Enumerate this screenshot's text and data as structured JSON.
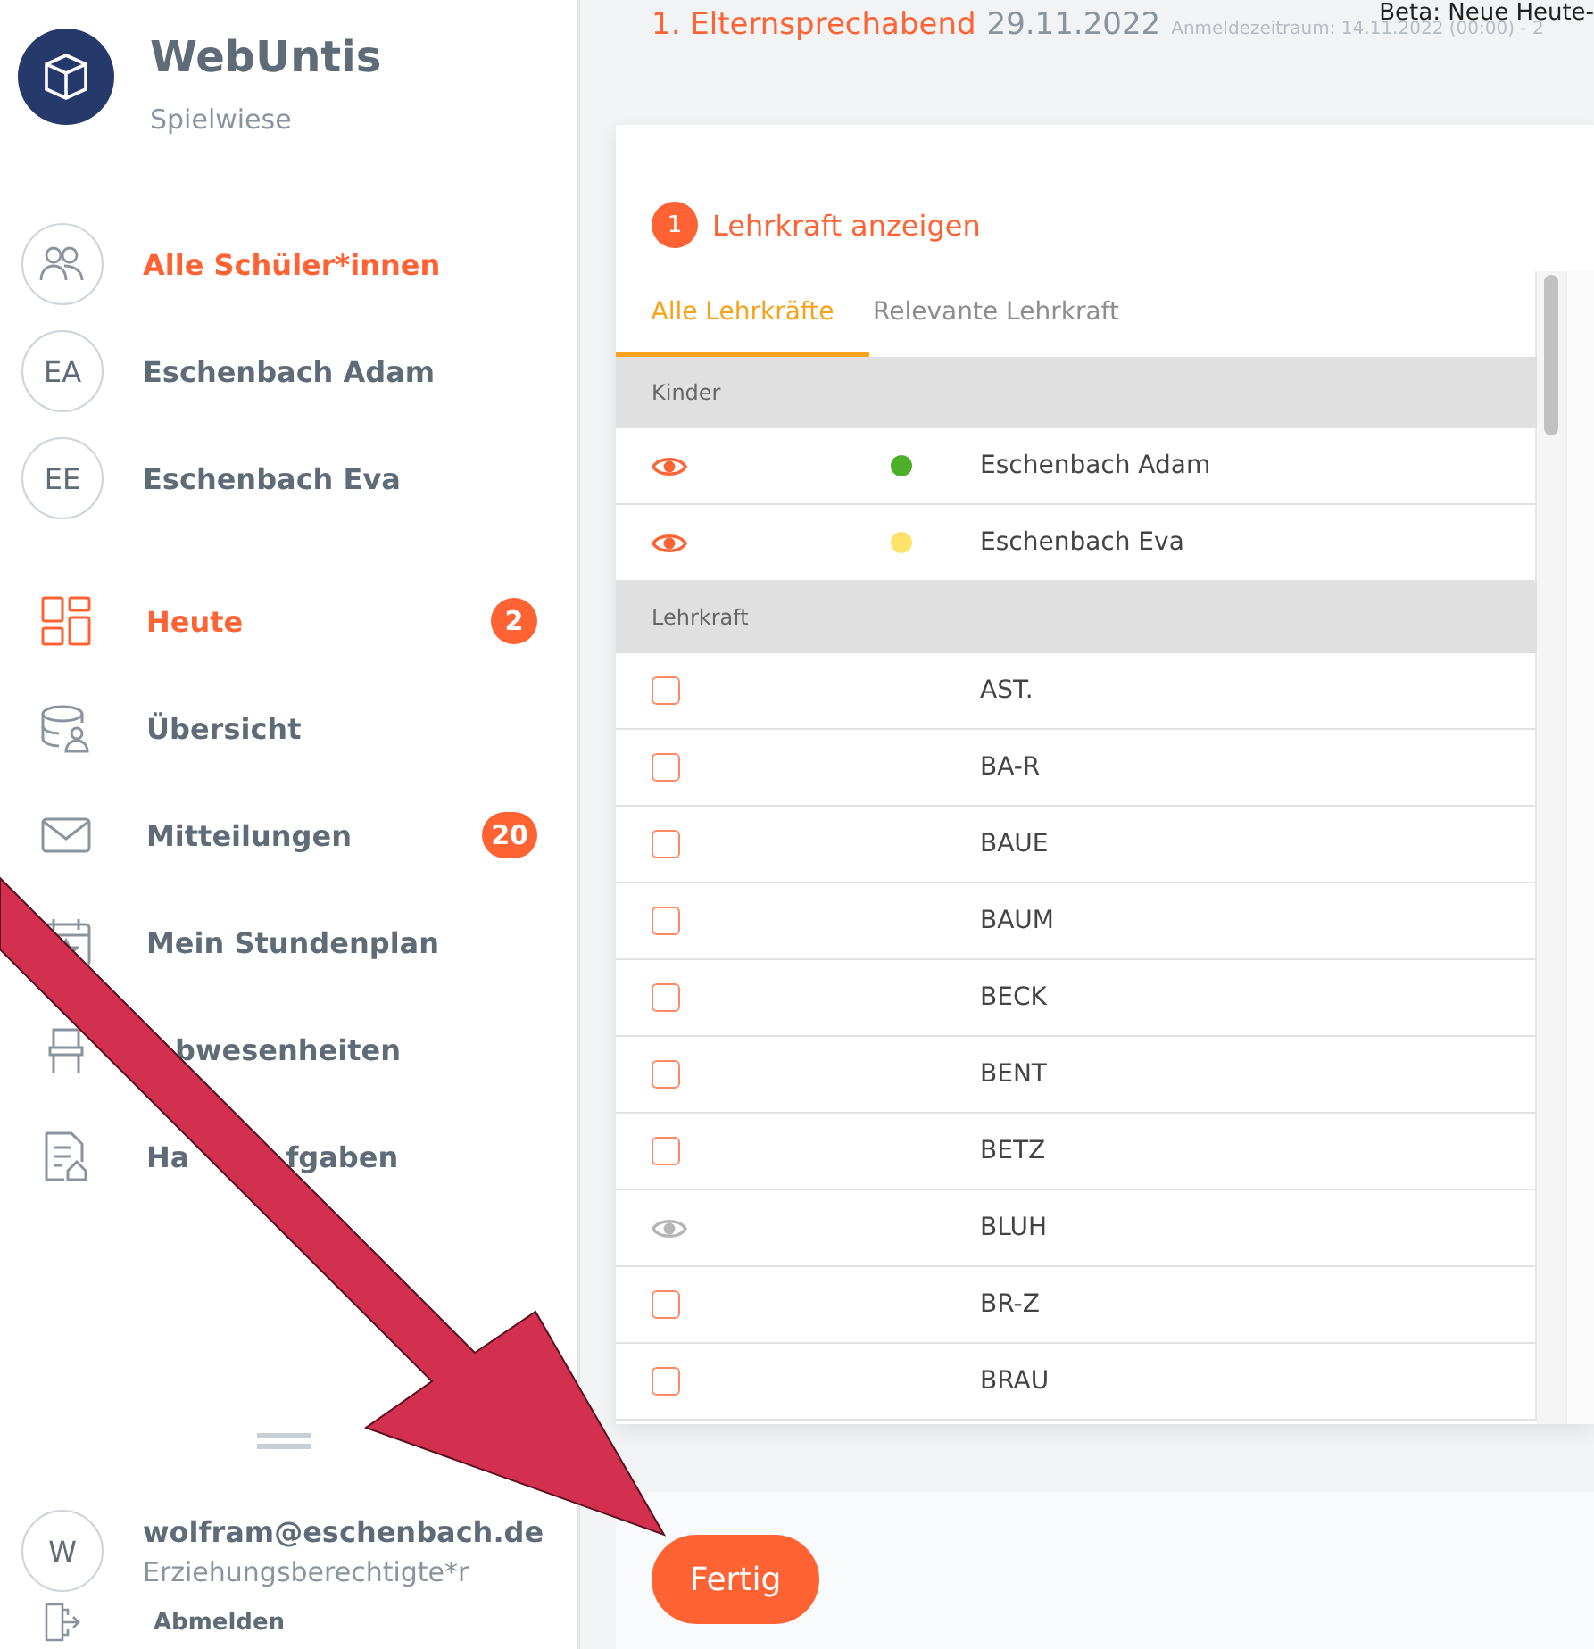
{
  "app": {
    "name": "WebUntis",
    "school": "Spielwiese"
  },
  "people": [
    {
      "kind": "group",
      "label": "Alle Schüler*innen",
      "selected": true
    },
    {
      "kind": "initials",
      "initials": "EA",
      "label": "Eschenbach Adam",
      "selected": false
    },
    {
      "kind": "initials",
      "initials": "EE",
      "label": "Eschenbach Eva",
      "selected": false
    }
  ],
  "nav": [
    {
      "kind": "dashboard",
      "label_parts": [
        "Heute"
      ],
      "selected": true,
      "badge": "2"
    },
    {
      "kind": "overview",
      "label_parts": [
        "Übersicht"
      ],
      "selected": false
    },
    {
      "kind": "mail",
      "label_parts": [
        "Mitteilungen"
      ],
      "selected": false,
      "badge": "20"
    },
    {
      "kind": "calendar",
      "label_parts": [
        "Mein Stundenplan"
      ],
      "selected": false
    },
    {
      "kind": "absence",
      "label_parts": [
        "bwesenheiten"
      ],
      "selected": false,
      "covered_start": true
    },
    {
      "kind": "homework",
      "label_parts": [
        "Ha",
        "fgaben"
      ],
      "selected": false
    }
  ],
  "user": {
    "initial": "W",
    "email": "wolfram@eschenbach.de",
    "role": "Erziehungsberechtigte*r",
    "logout": "Abmelden"
  },
  "header": {
    "title": "1. Elternsprechabend",
    "date": "29.11.2022",
    "period": "Anmeldezeitraum: 14.11.2022 (00:00) - 2",
    "beta": "Beta: Neue Heute-"
  },
  "card": {
    "step": "1",
    "title": "Lehrkraft anzeigen",
    "tabs": [
      {
        "label": "Alle Lehrkräfte",
        "selected": true
      },
      {
        "label": "Relevante Lehrkraft",
        "selected": false
      }
    ],
    "sections": [
      {
        "title": "Kinder",
        "rows": [
          {
            "kind": "child",
            "name": "Eschenbach Adam",
            "color": "#4caf2a"
          },
          {
            "kind": "child",
            "name": "Eschenbach Eva",
            "color": "#fde36a"
          }
        ]
      },
      {
        "title": "Lehrkraft",
        "rows": [
          {
            "kind": "checkbox",
            "name": "AST.",
            "checked": false
          },
          {
            "kind": "checkbox",
            "name": "BA-R",
            "checked": false
          },
          {
            "kind": "checkbox",
            "name": "BAUE",
            "checked": false
          },
          {
            "kind": "checkbox",
            "name": "BAUM",
            "checked": false
          },
          {
            "kind": "checkbox",
            "name": "BECK",
            "checked": false
          },
          {
            "kind": "checkbox",
            "name": "BENT",
            "checked": false
          },
          {
            "kind": "checkbox",
            "name": "BETZ",
            "checked": false
          },
          {
            "kind": "visible",
            "name": "BLUH"
          },
          {
            "kind": "checkbox",
            "name": "BR-Z",
            "checked": false
          },
          {
            "kind": "checkbox",
            "name": "BRAU",
            "checked": false
          }
        ]
      }
    ]
  },
  "done_button": "Fertig"
}
